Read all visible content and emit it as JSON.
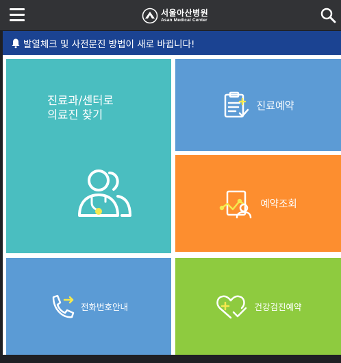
{
  "header": {
    "logo_ko": "서울아산병원",
    "logo_en": "Asan Medical Center",
    "icons": {
      "menu": "hamburger-menu-icon",
      "search": "search-icon",
      "logo": "hospital-emblem-icon"
    }
  },
  "notice": {
    "text": "발열체크 및 사전문진 방법이 새로 바뀝니다!",
    "icon": "bell-icon"
  },
  "tiles": [
    {
      "line1": "진료과/센터로",
      "line2": "의료진 찾기",
      "icon": "doctor-stethoscope-icon",
      "color": "#4abec0"
    },
    {
      "label": "진료예약",
      "icon": "clipboard-check-icon",
      "color": "#5c9bd5"
    },
    {
      "label": "예약조회",
      "icon": "chart-person-icon",
      "color": "#fd8e2f"
    },
    {
      "label": "전화번호안내",
      "icon": "phone-arrow-icon",
      "color": "#5b9bd5"
    },
    {
      "label": "건강검진예약",
      "icon": "heart-check-icon",
      "color": "#8ecb3f"
    }
  ]
}
